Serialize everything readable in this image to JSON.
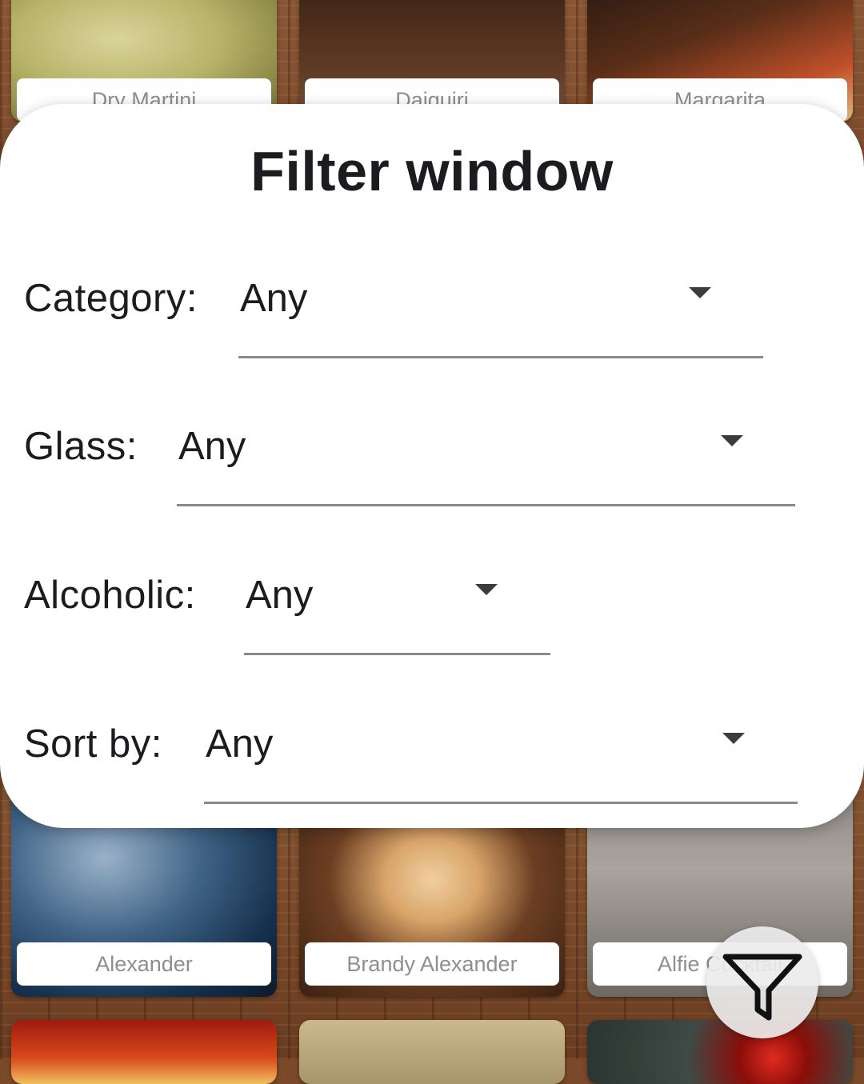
{
  "modal": {
    "title": "Filter window",
    "filters": [
      {
        "label": "Category:",
        "value": "Any"
      },
      {
        "label": "Glass:",
        "value": "Any"
      },
      {
        "label": "Alcoholic:",
        "value": "Any"
      },
      {
        "label": "Sort by:",
        "value": "Any"
      }
    ]
  },
  "cocktails": {
    "row1": [
      "Dry Martini",
      "Daiquiri",
      "Margarita"
    ],
    "row2": [
      "Alexander",
      "Brandy Alexander",
      "Alfie Cocktail"
    ]
  },
  "fab": {
    "icon": "filter-funnel-icon"
  }
}
